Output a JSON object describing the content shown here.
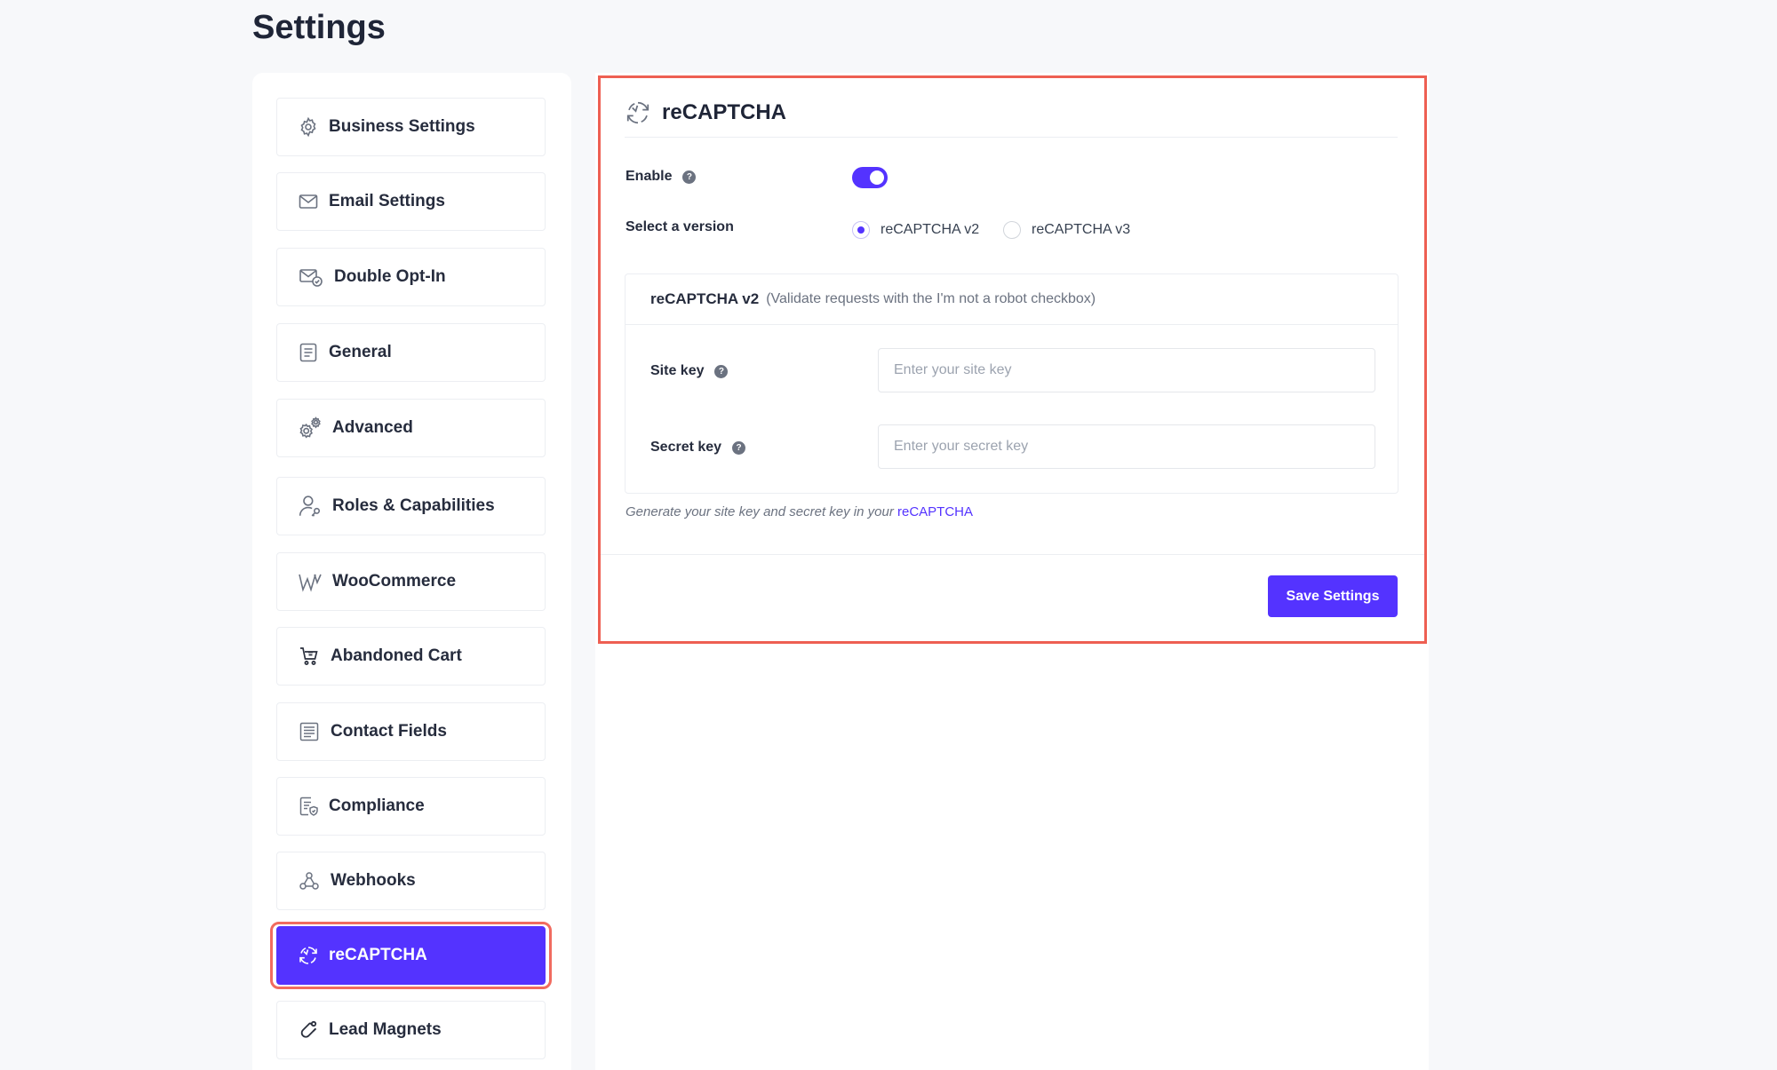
{
  "page": {
    "title": "Settings"
  },
  "sidebar": {
    "items": [
      {
        "label": "Business Settings",
        "icon": "gear-icon"
      },
      {
        "label": "Email Settings",
        "icon": "envelope-icon"
      },
      {
        "label": "Double Opt-In",
        "icon": "envelope-check-icon"
      },
      {
        "label": "General",
        "icon": "document-icon"
      },
      {
        "label": "Advanced",
        "icon": "gears-icon"
      },
      {
        "label": "Roles & Capabilities",
        "icon": "user-key-icon"
      },
      {
        "label": "WooCommerce",
        "icon": "woocommerce-icon"
      },
      {
        "label": "Abandoned Cart",
        "icon": "cart-icon"
      },
      {
        "label": "Contact Fields",
        "icon": "form-fields-icon"
      },
      {
        "label": "Compliance",
        "icon": "document-shield-icon"
      },
      {
        "label": "Webhooks",
        "icon": "webhook-icon"
      },
      {
        "label": "reCAPTCHA",
        "icon": "recaptcha-icon",
        "active": true
      },
      {
        "label": "Lead Magnets",
        "icon": "magnet-icon"
      }
    ]
  },
  "recaptcha": {
    "title": "reCAPTCHA",
    "enable_label": "Enable",
    "enabled": true,
    "version_label": "Select a version",
    "versions": [
      {
        "label": "reCAPTCHA v2",
        "checked": true
      },
      {
        "label": "reCAPTCHA v3",
        "checked": false
      }
    ],
    "v2_title": "reCAPTCHA v2",
    "v2_desc": "(Validate requests with the I'm not a robot checkbox)",
    "site_key_label": "Site key",
    "site_key_placeholder": "Enter your site key",
    "secret_key_label": "Secret key",
    "secret_key_placeholder": "Enter your secret key",
    "hint_text": "Generate your site key and secret key in your",
    "hint_link": "reCAPTCHA",
    "save_label": "Save Settings"
  },
  "colors": {
    "accent": "#5433ff",
    "highlight_outline": "#ee5f52"
  }
}
